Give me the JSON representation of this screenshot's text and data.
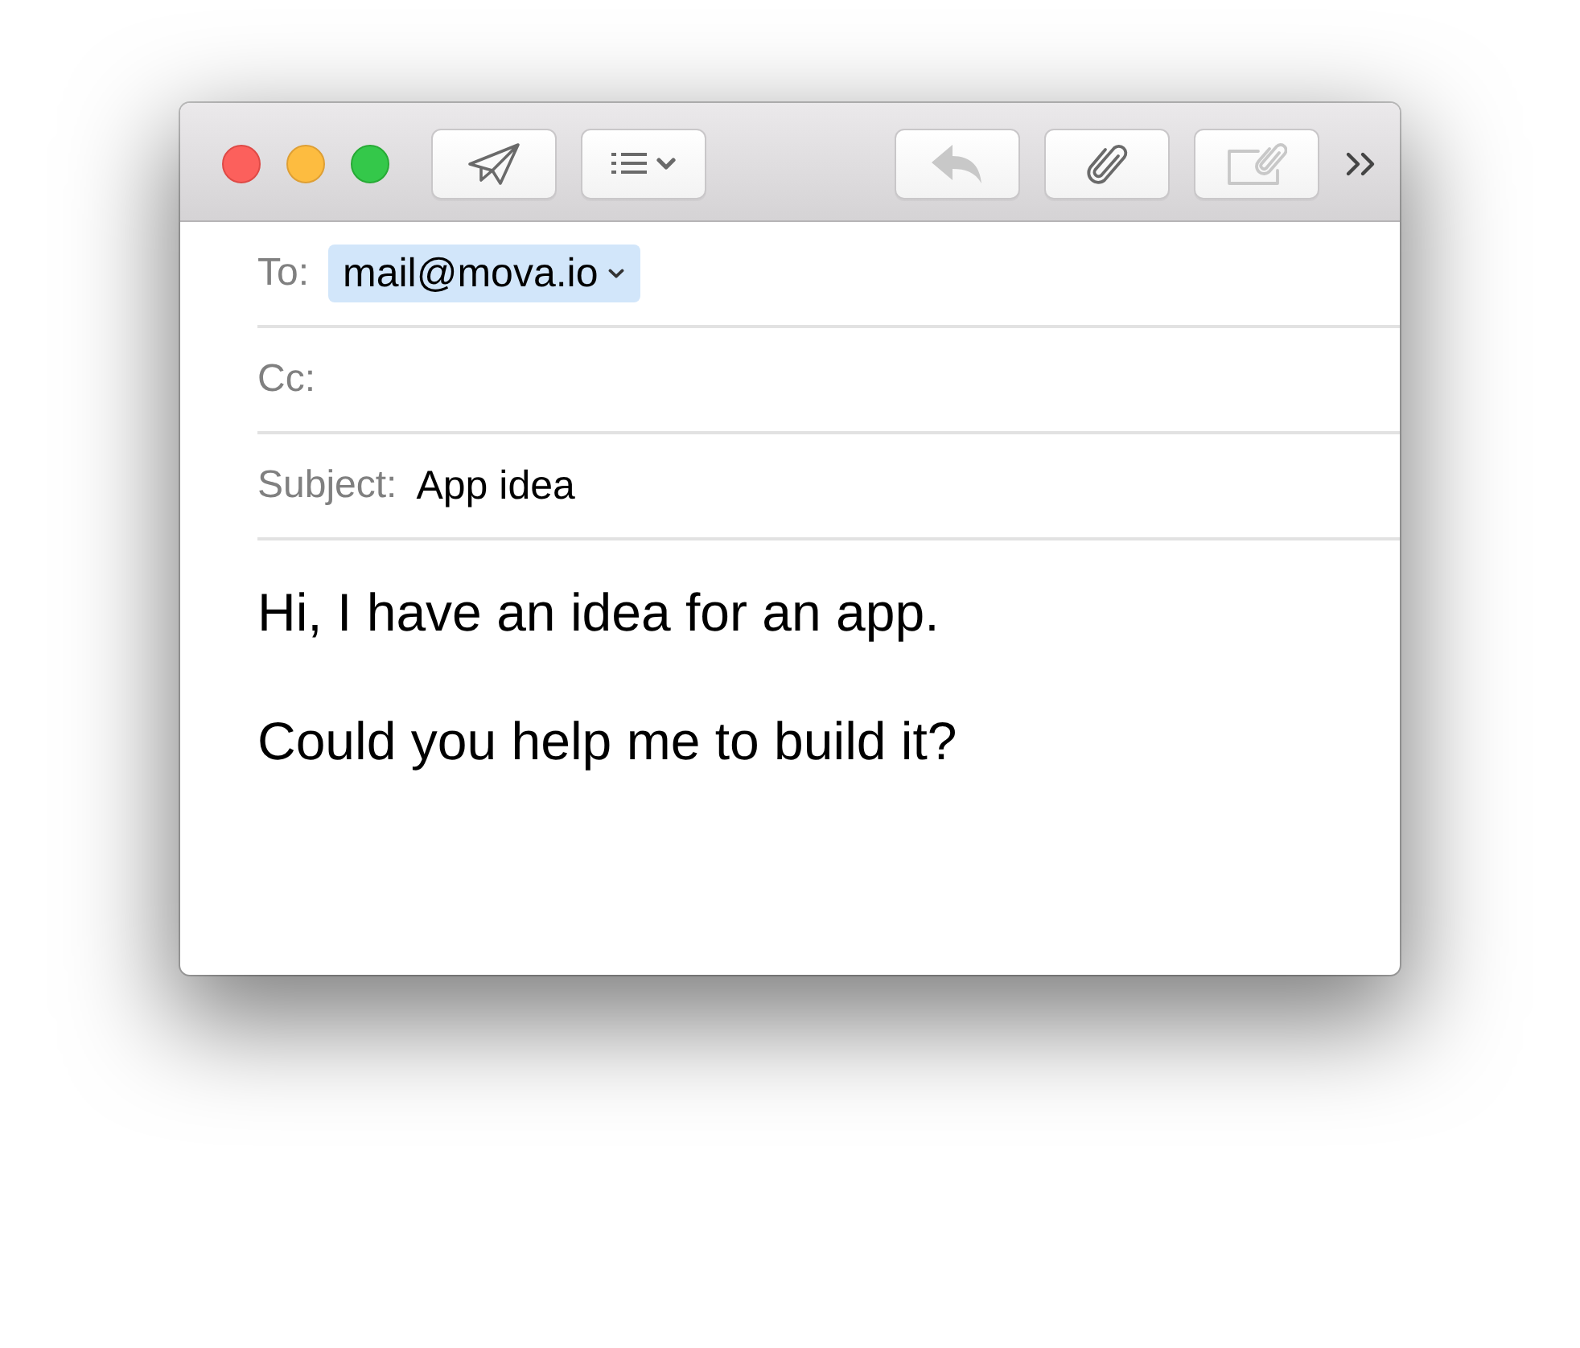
{
  "toolbar": {
    "left_buttons": [
      {
        "kind": "send",
        "disabled": false
      },
      {
        "kind": "format",
        "disabled": false
      }
    ],
    "right_buttons": [
      {
        "kind": "reply",
        "disabled": true
      },
      {
        "kind": "attach",
        "disabled": false
      },
      {
        "kind": "markup",
        "disabled": true
      }
    ]
  },
  "fields": [
    {
      "kind": "recipients",
      "label": "To:",
      "tokens": [
        "mail@mova.io"
      ]
    },
    {
      "kind": "recipients",
      "label": "Cc:"
    },
    {
      "kind": "subject",
      "label": "Subject:",
      "value": "App idea"
    }
  ],
  "body": {
    "paragraphs": [
      "Hi, I have an idea for an app.",
      "Could you help me to build it?"
    ]
  }
}
